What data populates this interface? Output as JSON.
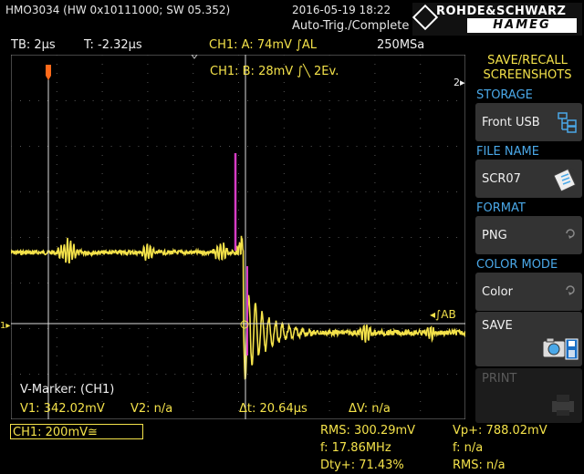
{
  "header": {
    "model": "HMO3034 (HW 0x10111000; SW 05.352)",
    "datetime": "2016-05-19 18:22",
    "status": "Auto-Trig./Complete",
    "brand_top": "ROHDE&SCHWARZ",
    "brand_bottom": "HAMEG"
  },
  "settings": {
    "timebase": "TB: 2µs",
    "trigger_time": "T: -2.32µs",
    "ch1a": "CH1: A: 74mV ∫AL",
    "sample_rate": "250MSa",
    "ch1b": "CH1: B: 28mV ∫╲ 2Ev."
  },
  "screen": {
    "ref_marker": "2▸",
    "trigger_label": "◂∫AB",
    "level_marker": "1▸",
    "v_marker": "V-Marker: (CH1)",
    "v1": "V1: 342.02mV",
    "v2": "V2: n/a",
    "dt": "Δt: 20.64µs",
    "dv": "ΔV: n/a"
  },
  "menu": {
    "title_line1": "SAVE/RECALL",
    "title_line2": "SCREENSHOTS",
    "storage_label": "STORAGE",
    "storage_value": "Front USB",
    "file_name_label": "FILE NAME",
    "file_name_value": "SCR07",
    "format_label": "FORMAT",
    "format_value": "PNG",
    "color_mode_label": "COLOR MODE",
    "color_mode_value": "Color",
    "save_label": "SAVE",
    "print_label": "PRINT"
  },
  "bottom": {
    "ch1_setting": "CH1: 200mV≅",
    "rms": "RMS: 300.29mV",
    "freq": "f: 17.86MHz",
    "duty": "Dty+: 71.43%",
    "vp": "Vp+: 788.02mV",
    "f_na": "f: n/a",
    "rms_na": "RMS: n/a"
  },
  "colors": {
    "trace": "#f4e24a",
    "trigger_trace": "#d63cc4",
    "accent_blue": "#4aa8e8",
    "marker_orange": "#ff6a1a"
  }
}
